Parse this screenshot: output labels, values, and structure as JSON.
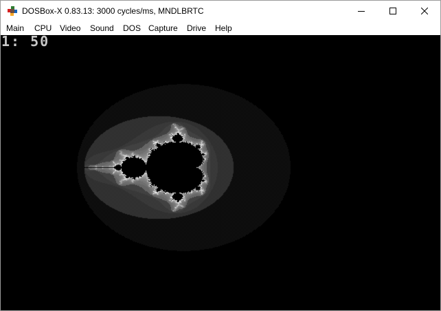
{
  "window": {
    "title": "DOSBox-X 0.83.13: 3000 cycles/ms, MNDLBRTC",
    "app_icon": "dosbox-icon",
    "controls": {
      "minimize_icon": "minimize-icon",
      "maximize_icon": "maximize-icon",
      "close_icon": "close-icon"
    }
  },
  "menubar": {
    "items": [
      {
        "label": "Main"
      },
      {
        "label": "CPU"
      },
      {
        "label": "Video"
      },
      {
        "label": "Sound"
      },
      {
        "label": "DOS"
      },
      {
        "label": "Capture"
      },
      {
        "label": "Drive"
      },
      {
        "label": "Help"
      }
    ]
  },
  "screen": {
    "status": "1: 50",
    "background": "#000000",
    "fractal_color": "#ffffff"
  }
}
